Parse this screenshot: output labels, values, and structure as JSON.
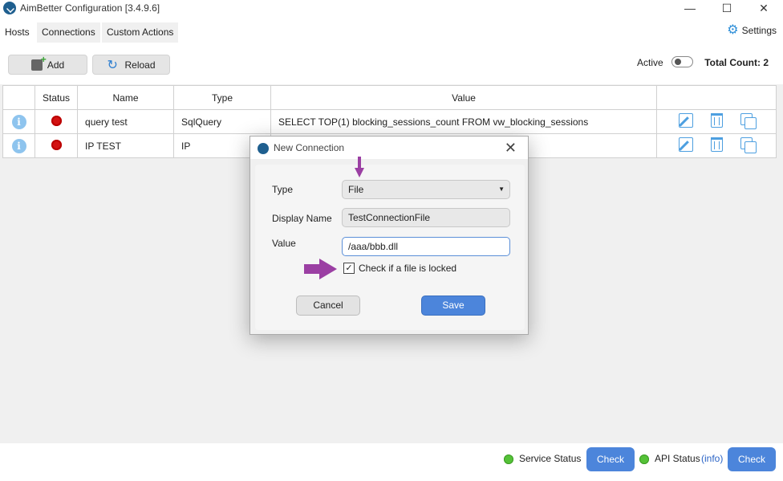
{
  "window": {
    "title": "AimBetter Configuration [3.4.9.6]",
    "minimize": "—",
    "maximize": "☐",
    "close": "✕"
  },
  "tabs": [
    {
      "label": "Hosts"
    },
    {
      "label": "Connections"
    },
    {
      "label": "Custom Actions"
    }
  ],
  "settings": {
    "label": "Settings",
    "icon": "gear-icon"
  },
  "toolbar": {
    "add_label": "Add",
    "reload_label": "Reload",
    "active_label": "Active",
    "active_on": false,
    "total_label": "Total Count: 2"
  },
  "table": {
    "columns": [
      "",
      "Status",
      "Name",
      "Type",
      "Value",
      ""
    ],
    "rows": [
      {
        "info": "i",
        "status": "red",
        "name": "query test",
        "type": "SqlQuery",
        "value": "SELECT TOP(1) blocking_sessions_count FROM vw_blocking_sessions"
      },
      {
        "info": "i",
        "status": "red",
        "name": "IP TEST",
        "type": "IP",
        "value": ""
      }
    ]
  },
  "dialog": {
    "title": "New Connection",
    "close": "✕",
    "type_label": "Type",
    "type_value": "File",
    "display_name_label": "Display Name",
    "display_name_value": "TestConnectionFile",
    "value_label": "Value",
    "value_value": "/aaa/bbb.dll",
    "checkbox_label": "Check if a file is locked",
    "checkbox_checked": true,
    "checkbox_mark": "✓",
    "cancel_label": "Cancel",
    "save_label": "Save"
  },
  "statusbar": {
    "service_label": "Service Status",
    "service_check": "Check",
    "api_label": "API Status",
    "api_info": "(info)",
    "api_check": "Check"
  },
  "colors": {
    "accent": "#4c85db",
    "status_red": "#d31212",
    "status_green": "#55c238",
    "annotation_arrow": "#9b3fa3"
  }
}
